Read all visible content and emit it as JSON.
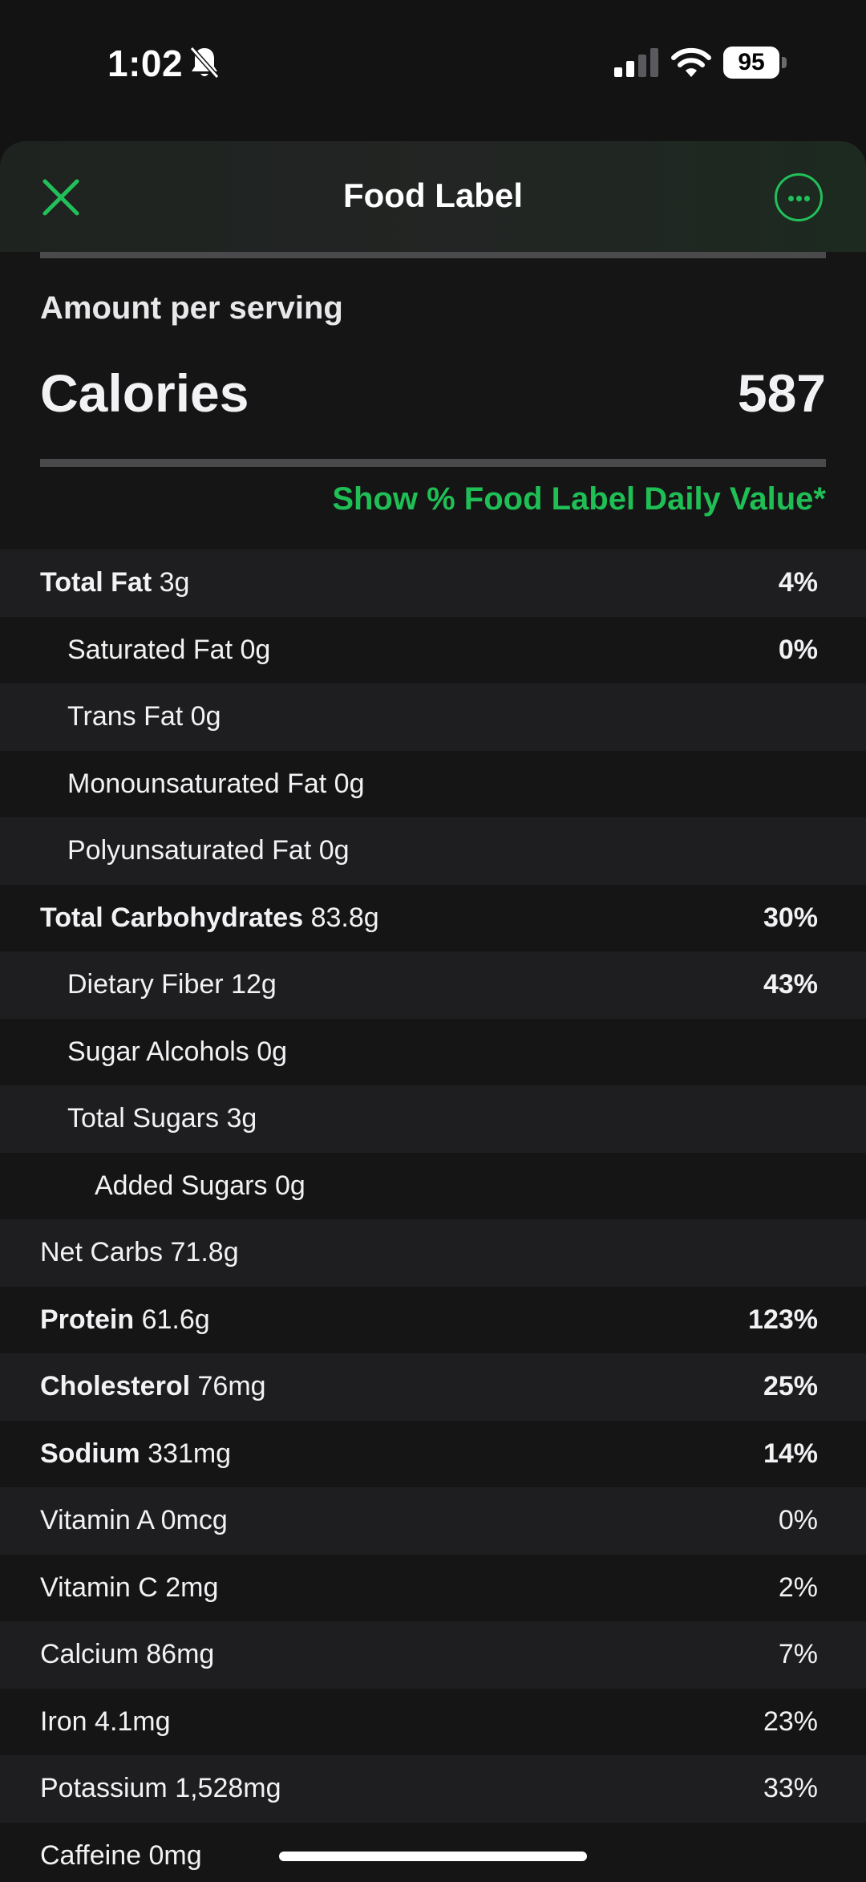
{
  "status_bar": {
    "time": "1:02",
    "battery": "95"
  },
  "header": {
    "title": "Food Label"
  },
  "summary": {
    "amount_label": "Amount per serving",
    "calories_label": "Calories",
    "calories_value": "587",
    "show_dv_link": "Show % Food Label Daily Value*"
  },
  "nutrients": [
    {
      "name": "Total Fat",
      "amount": "3g",
      "pct": "4%"
    },
    {
      "name": "Saturated Fat",
      "amount": "0g",
      "pct": "0%"
    },
    {
      "name": "Trans Fat",
      "amount": "0g",
      "pct": ""
    },
    {
      "name": "Monounsaturated Fat",
      "amount": "0g",
      "pct": ""
    },
    {
      "name": "Polyunsaturated Fat",
      "amount": "0g",
      "pct": ""
    },
    {
      "name": "Total Carbohydrates",
      "amount": "83.8g",
      "pct": "30%"
    },
    {
      "name": "Dietary Fiber",
      "amount": "12g",
      "pct": "43%"
    },
    {
      "name": "Sugar Alcohols",
      "amount": "0g",
      "pct": ""
    },
    {
      "name": "Total Sugars",
      "amount": "3g",
      "pct": ""
    },
    {
      "name": "Added Sugars",
      "amount": "0g",
      "pct": ""
    },
    {
      "name": "Net Carbs",
      "amount": "71.8g",
      "pct": ""
    },
    {
      "name": "Protein",
      "amount": "61.6g",
      "pct": "123%"
    },
    {
      "name": "Cholesterol",
      "amount": "76mg",
      "pct": "25%"
    },
    {
      "name": "Sodium",
      "amount": "331mg",
      "pct": "14%"
    },
    {
      "name": "Vitamin A",
      "amount": "0mcg",
      "pct": "0%"
    },
    {
      "name": "Vitamin C",
      "amount": "2mg",
      "pct": "2%"
    },
    {
      "name": "Calcium",
      "amount": "86mg",
      "pct": "7%"
    },
    {
      "name": "Iron",
      "amount": "4.1mg",
      "pct": "23%"
    },
    {
      "name": "Potassium",
      "amount": "1,528mg",
      "pct": "33%"
    },
    {
      "name": "Caffeine",
      "amount": "0mg",
      "pct": ""
    }
  ],
  "colors": {
    "accent": "#1fbf55",
    "background": "#131314",
    "row_alt": "#1e1e20"
  },
  "icons": {
    "close": "close-icon",
    "more": "more-icon",
    "bell_off": "bell-off-icon"
  }
}
